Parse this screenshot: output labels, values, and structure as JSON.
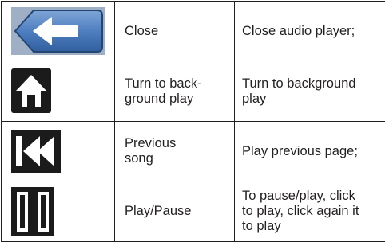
{
  "rows": [
    {
      "icon": "back-arrow-icon",
      "name": "Close",
      "description": "Close audio player;"
    },
    {
      "icon": "home-icon",
      "name": "Turn to back-\nground play",
      "description": "Turn to background\nplay"
    },
    {
      "icon": "previous-track-icon",
      "name": "Previous\nsong",
      "description": "Play previous page;"
    },
    {
      "icon": "pause-icon",
      "name": "Play/Pause",
      "description": "To pause/play, click\nto play, click again it\nto play"
    }
  ]
}
